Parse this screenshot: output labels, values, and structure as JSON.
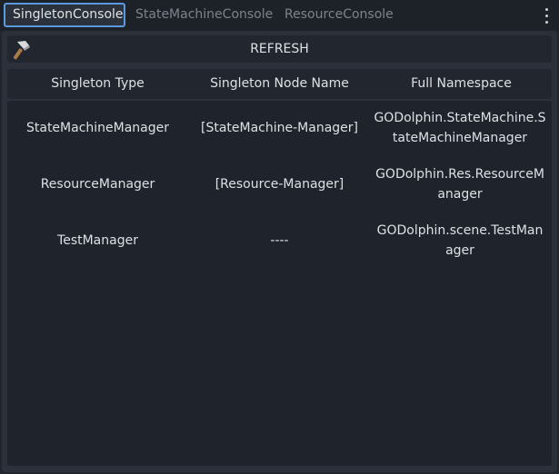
{
  "tabs": [
    {
      "label": "SingletonConsole",
      "active": true
    },
    {
      "label": "StateMachineConsole",
      "active": false
    },
    {
      "label": "ResourceConsole",
      "active": false
    }
  ],
  "toolbar": {
    "refresh_label": "REFRESH",
    "refresh_icon": "hammer-icon"
  },
  "table": {
    "headers": [
      "Singleton Type",
      "Singleton Node Name",
      "Full Namespace"
    ],
    "rows": [
      {
        "type": "StateMachineManager",
        "node_name": "[StateMachine-Manager]",
        "namespace": "GODolphin.StateMachine.StateMachineManager"
      },
      {
        "type": "ResourceManager",
        "node_name": "[Resource-Manager]",
        "namespace": "GODolphin.Res.ResourceManager"
      },
      {
        "type": "TestManager",
        "node_name": "----",
        "namespace": "GODolphin.scene.TestManager"
      }
    ]
  },
  "colors": {
    "background": "#21262e",
    "panel": "#2b303a",
    "tab_active_border": "#5b9ae0",
    "text": "#dde0e4",
    "text_muted": "#7d838c"
  }
}
